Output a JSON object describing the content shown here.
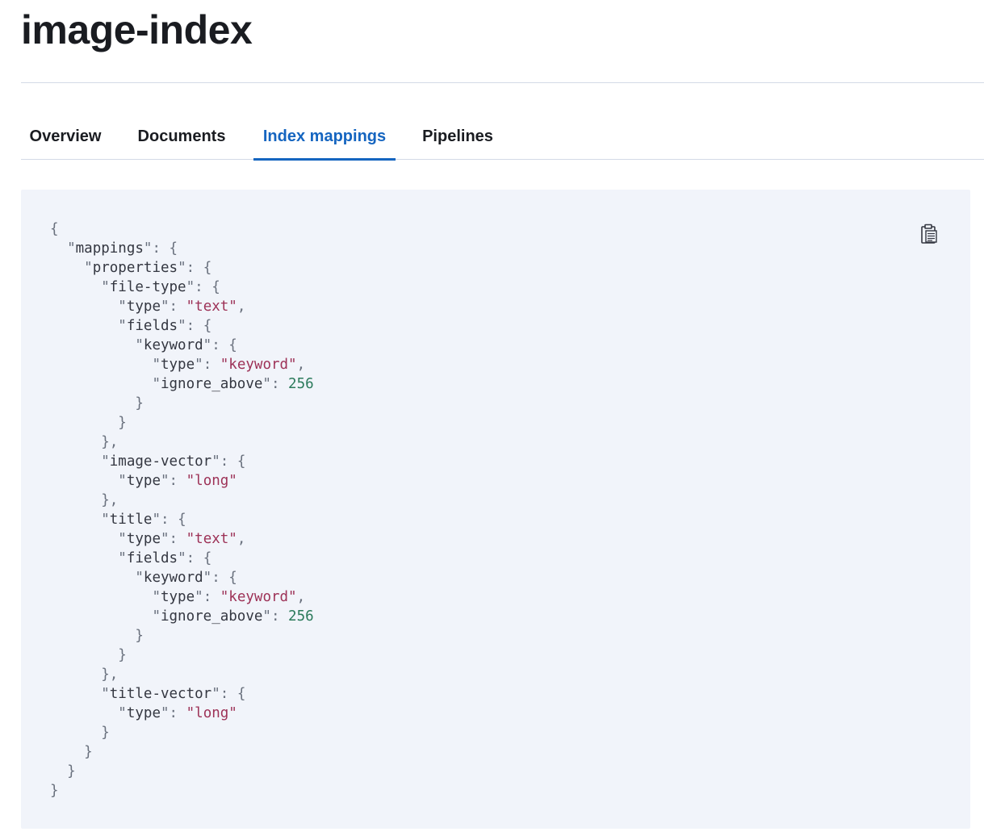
{
  "page": {
    "title": "image-index"
  },
  "tabs": [
    {
      "label": "Overview",
      "selected": false
    },
    {
      "label": "Documents",
      "selected": false
    },
    {
      "label": "Index mappings",
      "selected": true
    },
    {
      "label": "Pipelines",
      "selected": false
    }
  ],
  "colors": {
    "accent": "#1565c0",
    "panel_background": "#f1f4fa",
    "string_value": "#9d3257",
    "number_value": "#2b7a5b"
  },
  "code_panel": {
    "copy_icon": "clipboard-icon",
    "mappings": {
      "mappings": {
        "properties": {
          "file-type": {
            "type": "text",
            "fields": {
              "keyword": {
                "type": "keyword",
                "ignore_above": 256
              }
            }
          },
          "image-vector": {
            "type": "long"
          },
          "title": {
            "type": "text",
            "fields": {
              "keyword": {
                "type": "keyword",
                "ignore_above": 256
              }
            }
          },
          "title-vector": {
            "type": "long"
          }
        }
      }
    }
  }
}
